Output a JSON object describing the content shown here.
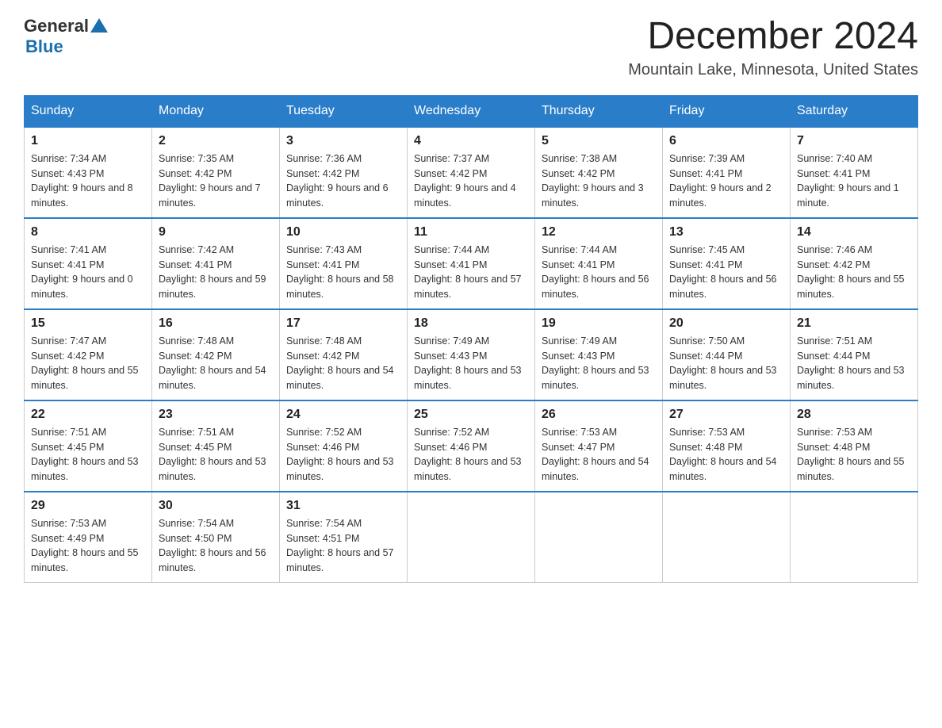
{
  "header": {
    "logo_general": "General",
    "logo_blue": "Blue",
    "month_title": "December 2024",
    "location": "Mountain Lake, Minnesota, United States"
  },
  "days_of_week": [
    "Sunday",
    "Monday",
    "Tuesday",
    "Wednesday",
    "Thursday",
    "Friday",
    "Saturday"
  ],
  "weeks": [
    [
      {
        "day": "1",
        "sunrise": "7:34 AM",
        "sunset": "4:43 PM",
        "daylight": "9 hours and 8 minutes."
      },
      {
        "day": "2",
        "sunrise": "7:35 AM",
        "sunset": "4:42 PM",
        "daylight": "9 hours and 7 minutes."
      },
      {
        "day": "3",
        "sunrise": "7:36 AM",
        "sunset": "4:42 PM",
        "daylight": "9 hours and 6 minutes."
      },
      {
        "day": "4",
        "sunrise": "7:37 AM",
        "sunset": "4:42 PM",
        "daylight": "9 hours and 4 minutes."
      },
      {
        "day": "5",
        "sunrise": "7:38 AM",
        "sunset": "4:42 PM",
        "daylight": "9 hours and 3 minutes."
      },
      {
        "day": "6",
        "sunrise": "7:39 AM",
        "sunset": "4:41 PM",
        "daylight": "9 hours and 2 minutes."
      },
      {
        "day": "7",
        "sunrise": "7:40 AM",
        "sunset": "4:41 PM",
        "daylight": "9 hours and 1 minute."
      }
    ],
    [
      {
        "day": "8",
        "sunrise": "7:41 AM",
        "sunset": "4:41 PM",
        "daylight": "9 hours and 0 minutes."
      },
      {
        "day": "9",
        "sunrise": "7:42 AM",
        "sunset": "4:41 PM",
        "daylight": "8 hours and 59 minutes."
      },
      {
        "day": "10",
        "sunrise": "7:43 AM",
        "sunset": "4:41 PM",
        "daylight": "8 hours and 58 minutes."
      },
      {
        "day": "11",
        "sunrise": "7:44 AM",
        "sunset": "4:41 PM",
        "daylight": "8 hours and 57 minutes."
      },
      {
        "day": "12",
        "sunrise": "7:44 AM",
        "sunset": "4:41 PM",
        "daylight": "8 hours and 56 minutes."
      },
      {
        "day": "13",
        "sunrise": "7:45 AM",
        "sunset": "4:41 PM",
        "daylight": "8 hours and 56 minutes."
      },
      {
        "day": "14",
        "sunrise": "7:46 AM",
        "sunset": "4:42 PM",
        "daylight": "8 hours and 55 minutes."
      }
    ],
    [
      {
        "day": "15",
        "sunrise": "7:47 AM",
        "sunset": "4:42 PM",
        "daylight": "8 hours and 55 minutes."
      },
      {
        "day": "16",
        "sunrise": "7:48 AM",
        "sunset": "4:42 PM",
        "daylight": "8 hours and 54 minutes."
      },
      {
        "day": "17",
        "sunrise": "7:48 AM",
        "sunset": "4:42 PM",
        "daylight": "8 hours and 54 minutes."
      },
      {
        "day": "18",
        "sunrise": "7:49 AM",
        "sunset": "4:43 PM",
        "daylight": "8 hours and 53 minutes."
      },
      {
        "day": "19",
        "sunrise": "7:49 AM",
        "sunset": "4:43 PM",
        "daylight": "8 hours and 53 minutes."
      },
      {
        "day": "20",
        "sunrise": "7:50 AM",
        "sunset": "4:44 PM",
        "daylight": "8 hours and 53 minutes."
      },
      {
        "day": "21",
        "sunrise": "7:51 AM",
        "sunset": "4:44 PM",
        "daylight": "8 hours and 53 minutes."
      }
    ],
    [
      {
        "day": "22",
        "sunrise": "7:51 AM",
        "sunset": "4:45 PM",
        "daylight": "8 hours and 53 minutes."
      },
      {
        "day": "23",
        "sunrise": "7:51 AM",
        "sunset": "4:45 PM",
        "daylight": "8 hours and 53 minutes."
      },
      {
        "day": "24",
        "sunrise": "7:52 AM",
        "sunset": "4:46 PM",
        "daylight": "8 hours and 53 minutes."
      },
      {
        "day": "25",
        "sunrise": "7:52 AM",
        "sunset": "4:46 PM",
        "daylight": "8 hours and 53 minutes."
      },
      {
        "day": "26",
        "sunrise": "7:53 AM",
        "sunset": "4:47 PM",
        "daylight": "8 hours and 54 minutes."
      },
      {
        "day": "27",
        "sunrise": "7:53 AM",
        "sunset": "4:48 PM",
        "daylight": "8 hours and 54 minutes."
      },
      {
        "day": "28",
        "sunrise": "7:53 AM",
        "sunset": "4:48 PM",
        "daylight": "8 hours and 55 minutes."
      }
    ],
    [
      {
        "day": "29",
        "sunrise": "7:53 AM",
        "sunset": "4:49 PM",
        "daylight": "8 hours and 55 minutes."
      },
      {
        "day": "30",
        "sunrise": "7:54 AM",
        "sunset": "4:50 PM",
        "daylight": "8 hours and 56 minutes."
      },
      {
        "day": "31",
        "sunrise": "7:54 AM",
        "sunset": "4:51 PM",
        "daylight": "8 hours and 57 minutes."
      },
      null,
      null,
      null,
      null
    ]
  ]
}
